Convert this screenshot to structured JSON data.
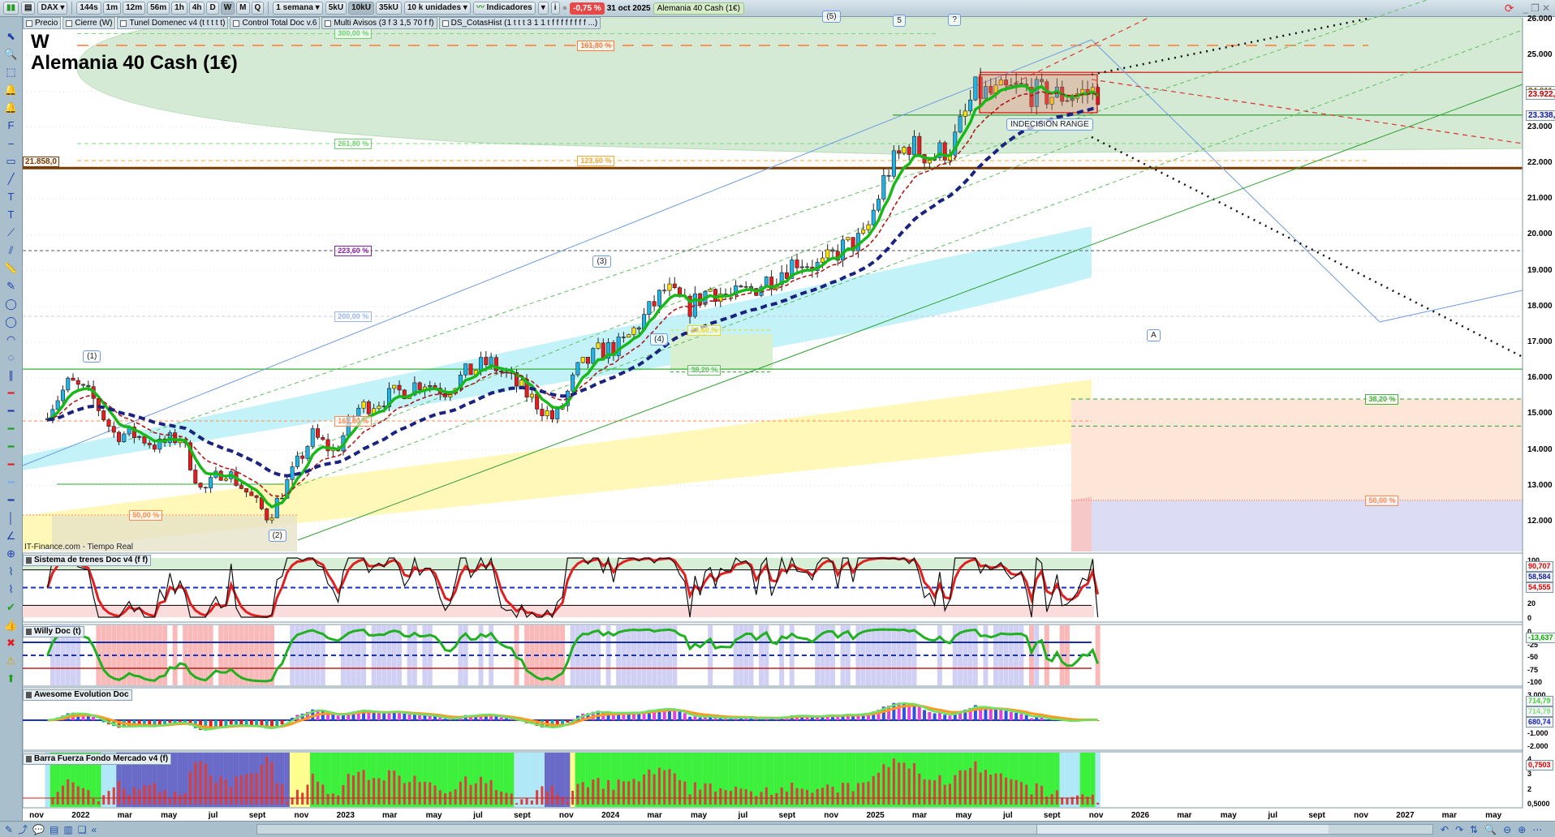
{
  "toolbar": {
    "symbol": "DAX",
    "timeframes": [
      "144s",
      "1m",
      "12m",
      "56m",
      "1h",
      "4h",
      "D",
      "W",
      "M",
      "Q"
    ],
    "active_timeframe": "W",
    "period_select": "1 semana",
    "units": [
      "5kU",
      "10kU",
      "35kU"
    ],
    "active_unit": "10kU",
    "units_select": "10 k unidades",
    "indicators_label": "Indicadores",
    "change": "-0,75 %",
    "date": "31 oct 2025",
    "instrument": "Alemania 40 Cash (1€)"
  },
  "chips": [
    "Precio",
    "Cierre (W)",
    "Tunel Domenec v4 (t t t t t)",
    "Control Total Doc v.6",
    "Multi Avisos (3 f 3 1,5 70 f f)",
    "DS_CotasHist (1 t t t 3 1 1 t f f f f f f f f ...)"
  ],
  "left_tools": [
    "pointer-icon",
    "zoom-icon",
    "zoom-area-icon",
    "alert-bell-x-icon",
    "alert-bell-icon",
    "fibonacci-icon",
    "fib-line-icon",
    "rectangle-icon",
    "trendline-icon",
    "text-icon",
    "text-alt-icon",
    "segment-icon",
    "channel-icon",
    "ruler-icon",
    "pencil-icon",
    "ellipse-icon",
    "ellipse-alt-icon",
    "arc-icon",
    "cycle-icon",
    "parallel-icon",
    "red-line-icon",
    "hline-icon",
    "green-line-icon",
    "green-line-2-icon",
    "red-line-2-icon",
    "lightblue-line-icon",
    "blue-line-icon",
    "vline-icon",
    "angle-icon",
    "circle-plus-icon",
    "elliott-wave-icon",
    "abc-wave-icon",
    "check-icon",
    "thumbs-up-icon",
    "cross-icon",
    "warning-icon",
    "arrow-up-icon"
  ],
  "chart": {
    "period": "W",
    "title": "Alemania 40 Cash (1€)",
    "source": "IT-Finance.com - Tiempo Real",
    "price_tag": "21.858,0",
    "indecision": "INDECISION RANGE",
    "y_ticks": [
      "26.000",
      "25.000",
      "24.000",
      "23.000",
      "22.000",
      "21.000",
      "20.000",
      "19.000",
      "18.000",
      "17.000",
      "16.000",
      "15.000",
      "14.000",
      "13.000",
      "12.000"
    ],
    "tags": [
      {
        "text": "24.011,5",
        "color": "#a06000",
        "price": 24011.5
      },
      {
        "text": "23.922,4",
        "color": "#c00000",
        "price": 23922.4
      },
      {
        "text": "23.338,2",
        "color": "#1020a0",
        "price": 23338.2
      }
    ],
    "fib_labels": [
      {
        "text": "300,00 %",
        "color": "#6fd36f",
        "price": 25609,
        "month": 13.5
      },
      {
        "text": "161,80 %",
        "color": "#ff7a3a",
        "price": 25280,
        "month": 24.5
      },
      {
        "text": "261,80 %",
        "color": "#6fd36f",
        "price": 22543,
        "month": 13.5
      },
      {
        "text": "123,60 %",
        "color": "#f0a830",
        "price": 22068,
        "month": 24.5
      },
      {
        "text": "223,60 %",
        "color": "#8a1ea8",
        "price": 19557,
        "month": 13.5
      },
      {
        "text": "200,00 %",
        "color": "#9bb5f0",
        "price": 17724,
        "month": 13.5
      },
      {
        "text": "23,60 %",
        "color": "#e8d820",
        "price": 17340,
        "month": 29.5
      },
      {
        "text": "38,20 %",
        "color": "#60c060",
        "price": 16230,
        "month": 29.5
      },
      {
        "text": "161,80 %",
        "color": "#ff8a50",
        "price": 14805,
        "month": 13.5
      },
      {
        "text": "50,00 %",
        "color": "#ff8a50",
        "price": 12180,
        "month": 4.2
      },
      {
        "text": "38,20 %",
        "color": "#40b040",
        "price": 15416,
        "month": 60.2
      },
      {
        "text": "50,00 %",
        "color": "#ff8a50",
        "price": 12590,
        "month": 60.2
      }
    ],
    "waves": [
      {
        "text": "(1)",
        "month": 2.1,
        "price": 16600
      },
      {
        "text": "(2)",
        "month": 10.5,
        "price": 11600
      },
      {
        "text": "(3)",
        "month": 25.2,
        "price": 19250
      },
      {
        "text": "(4)",
        "month": 27.8,
        "price": 17060
      },
      {
        "text": "(5)",
        "month": 35.6,
        "price": 26080
      },
      {
        "text": "5",
        "month": 38.8,
        "price": 25950
      },
      {
        "text": "?",
        "month": 41.3,
        "price": 25980
      },
      {
        "text": "A",
        "month": 50.3,
        "price": 17180
      }
    ]
  },
  "chart_data": {
    "type": "line",
    "title": "Alemania 40 Cash (1€) — W",
    "x_start": "2021-11",
    "x_unit": "month",
    "ylim": [
      11500,
      26200
    ],
    "series": [
      {
        "name": "Close (monthly approx.)",
        "values": [
          15100,
          15885,
          15470,
          14460,
          14415,
          14100,
          14390,
          12780,
          13480,
          12830,
          12110,
          13250,
          14400,
          13920,
          15130,
          15360,
          15630,
          15920,
          15660,
          16150,
          16450,
          15950,
          15390,
          14810,
          16210,
          16750,
          16900,
          17680,
          18490,
          17930,
          18500,
          18230,
          18510,
          18900,
          19320,
          19080,
          19630,
          19900,
          21730,
          22550,
          22160,
          22500,
          23990,
          23910,
          24070,
          23900,
          23880,
          23960
        ]
      }
    ],
    "levels": {
      "brown_line": 21858,
      "red_resistance": 24530,
      "green_support": 23338.2,
      "green_level": 16250
    }
  },
  "x_axis": [
    {
      "t": "nov",
      "m": 0
    },
    {
      "t": "2022",
      "m": 2
    },
    {
      "t": "mar",
      "m": 4
    },
    {
      "t": "may",
      "m": 6
    },
    {
      "t": "jul",
      "m": 8
    },
    {
      "t": "sept",
      "m": 10
    },
    {
      "t": "nov",
      "m": 12
    },
    {
      "t": "2023",
      "m": 14
    },
    {
      "t": "mar",
      "m": 16
    },
    {
      "t": "may",
      "m": 18
    },
    {
      "t": "jul",
      "m": 20
    },
    {
      "t": "sept",
      "m": 22
    },
    {
      "t": "nov",
      "m": 24
    },
    {
      "t": "2024",
      "m": 26
    },
    {
      "t": "mar",
      "m": 28
    },
    {
      "t": "may",
      "m": 30
    },
    {
      "t": "jul",
      "m": 32
    },
    {
      "t": "sept",
      "m": 34
    },
    {
      "t": "nov",
      "m": 36
    },
    {
      "t": "2025",
      "m": 38
    },
    {
      "t": "mar",
      "m": 40
    },
    {
      "t": "may",
      "m": 42
    },
    {
      "t": "jul",
      "m": 44
    },
    {
      "t": "sept",
      "m": 46
    },
    {
      "t": "nov",
      "m": 48
    },
    {
      "t": "2026",
      "m": 50
    },
    {
      "t": "mar",
      "m": 52
    },
    {
      "t": "may",
      "m": 54
    },
    {
      "t": "jul",
      "m": 56
    },
    {
      "t": "sept",
      "m": 58
    },
    {
      "t": "nov",
      "m": 60
    },
    {
      "t": "2027",
      "m": 62
    },
    {
      "t": "mar",
      "m": 64
    },
    {
      "t": "may",
      "m": 66
    }
  ],
  "panes": [
    {
      "title": "Sistema de trenes Doc v4 (f f)",
      "ticks": [
        "100",
        "80",
        "50",
        "20",
        "0"
      ],
      "tags": [
        {
          "text": "90,707",
          "color": "#e00000"
        },
        {
          "text": "58,584",
          "color": "#1020a0"
        },
        {
          "text": "54,555",
          "color": "#e00000"
        }
      ]
    },
    {
      "title": "Willy Doc (t)",
      "ticks": [
        "0",
        "-25",
        "-50",
        "-75",
        "-100"
      ],
      "tags": [
        {
          "text": "-13,637",
          "color": "#00b000"
        }
      ]
    },
    {
      "title": "Awesome Evolution Doc",
      "ticks": [
        "3.000",
        "2.000",
        "0",
        "-1.000",
        "-2.000"
      ],
      "tags": [
        {
          "text": "714,79",
          "color": "#40d040"
        },
        {
          "text": "714,79",
          "color": "#80e080"
        },
        {
          "text": "680,74",
          "color": "#1020c0"
        }
      ]
    },
    {
      "title": "Barra Fuerza Fondo Mercado v4 (f)",
      "ticks": [
        "4",
        "3",
        "2",
        "0,5000"
      ],
      "tags": [
        {
          "text": "0,7503",
          "color": "#e00000"
        }
      ]
    }
  ],
  "colors": {
    "up_strong": "#1fb4e8",
    "up_weak": "#ffe400",
    "down": "#e81c1c",
    "doji": "#5f6f5f",
    "ma_fast": "#18b818",
    "ma_mid": "#b01818",
    "ma_slow": "#1a237e"
  }
}
